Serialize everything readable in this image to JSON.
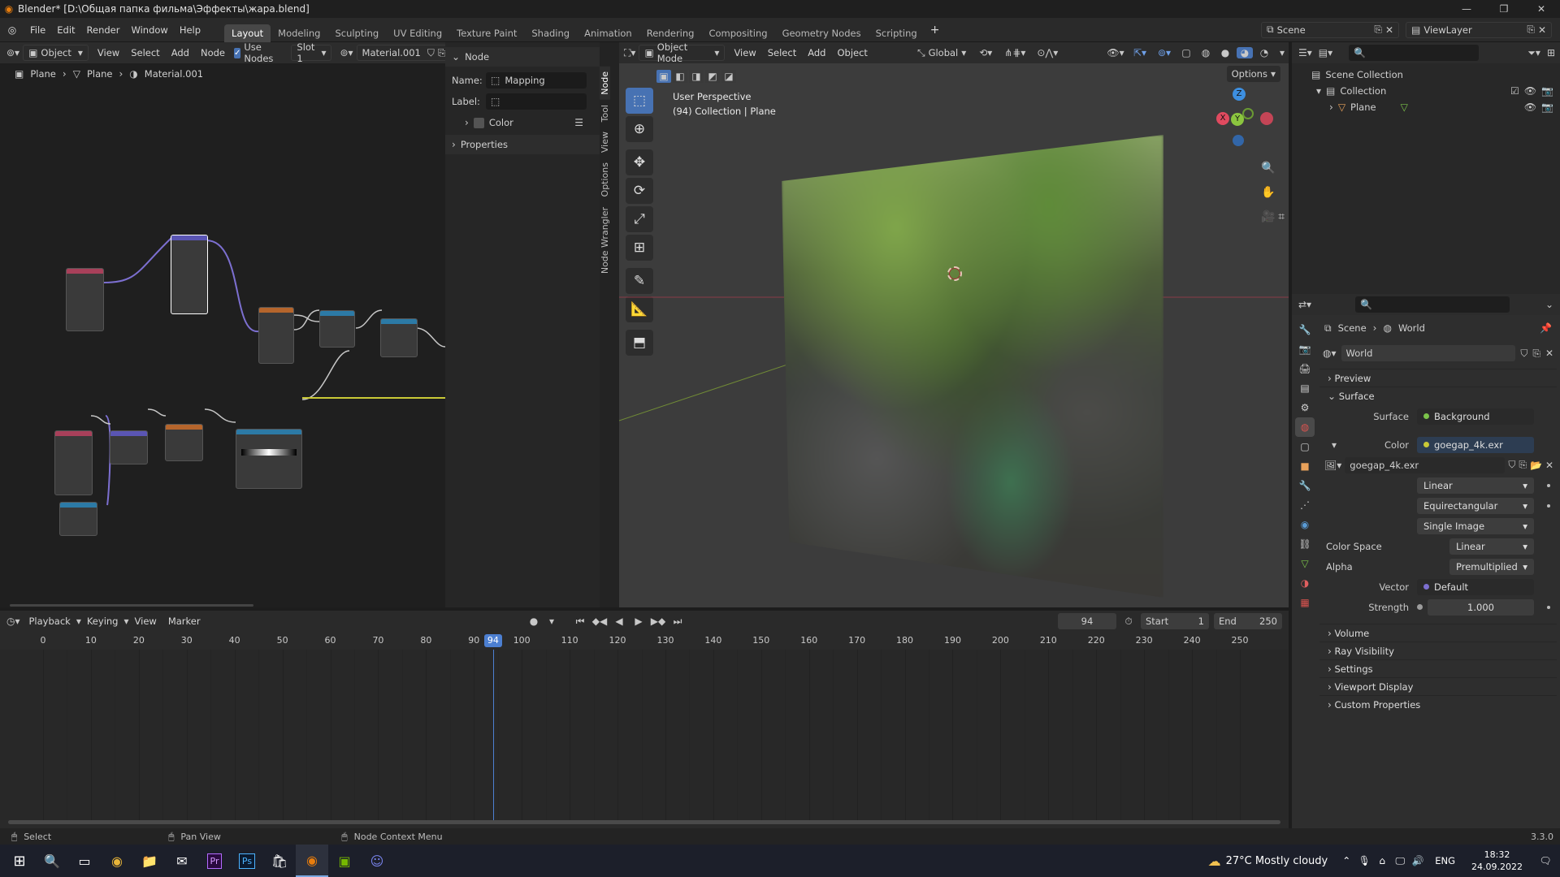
{
  "window": {
    "title": "Blender* [D:\\Общая папка фильма\\Эффекты\\жара.blend]",
    "min_icon": "—",
    "max_icon": "❐",
    "close_icon": "✕"
  },
  "menubar": {
    "items": [
      "File",
      "Edit",
      "Render",
      "Window",
      "Help"
    ]
  },
  "workspaces": {
    "tabs": [
      "Layout",
      "Modeling",
      "Sculpting",
      "UV Editing",
      "Texture Paint",
      "Shading",
      "Animation",
      "Rendering",
      "Compositing",
      "Geometry Nodes",
      "Scripting"
    ],
    "active": "Layout",
    "add": "+"
  },
  "scene": {
    "label": "Scene",
    "view_layer": "ViewLayer"
  },
  "node_editor": {
    "mode": "Object",
    "menus": [
      "View",
      "Select",
      "Add",
      "Node"
    ],
    "use_nodes": "Use Nodes",
    "slot": "Slot 1",
    "material": "Material.001",
    "breadcrumb": [
      "Plane",
      "Plane",
      "Material.001"
    ]
  },
  "npanel": {
    "section": "Node",
    "name_label": "Name:",
    "name_value": "Mapping",
    "label_label": "Label:",
    "label_value": "",
    "color": "Color",
    "properties": "Properties",
    "tabs": [
      "Node",
      "Tool",
      "View",
      "Options",
      "Node Wrangler"
    ]
  },
  "viewport": {
    "mode": "Object Mode",
    "menus": [
      "View",
      "Select",
      "Add",
      "Object"
    ],
    "orientation": "Global",
    "options": "Options",
    "perspective": "User Perspective",
    "collection": "(94) Collection | Plane",
    "gizmo": {
      "z": "Z",
      "y": "Y",
      "x": "X"
    }
  },
  "outliner": {
    "root": "Scene Collection",
    "collection": "Collection",
    "object": "Plane"
  },
  "properties": {
    "breadcrumb": [
      "Scene",
      "World"
    ],
    "world": "World",
    "sections": {
      "preview": "Preview",
      "surface": "Surface",
      "volume": "Volume",
      "ray_visibility": "Ray Visibility",
      "settings": "Settings",
      "viewport_display": "Viewport Display",
      "custom_properties": "Custom Properties"
    },
    "surface_label": "Surface",
    "surface_value": "Background",
    "color_label": "Color",
    "color_value": "goegap_4k.exr",
    "image_name": "goegap_4k.exr",
    "interp": "Linear",
    "projection": "Equirectangular",
    "source": "Single Image",
    "colorspace_label": "Color Space",
    "colorspace_value": "Linear",
    "alpha_label": "Alpha",
    "alpha_value": "Premultiplied",
    "vector_label": "Vector",
    "vector_value": "Default",
    "strength_label": "Strength",
    "strength_value": "1.000"
  },
  "timeline": {
    "menus": [
      "Playback",
      "Keying",
      "View",
      "Marker"
    ],
    "current_frame": "94",
    "start_label": "Start",
    "start_value": "1",
    "end_label": "End",
    "end_value": "250",
    "ticks": [
      "0",
      "10",
      "20",
      "30",
      "40",
      "50",
      "60",
      "70",
      "80",
      "90",
      "100",
      "110",
      "120",
      "130",
      "140",
      "150",
      "160",
      "170",
      "180",
      "190",
      "200",
      "210",
      "220",
      "230",
      "240",
      "250"
    ],
    "playhead": "94",
    "playhead_fraction": 0.376
  },
  "statusbar": {
    "select": "Select",
    "pan": "Pan View",
    "context": "Node Context Menu",
    "version": "3.3.0"
  },
  "taskbar": {
    "weather": "27°C  Mostly cloudy",
    "lang": "ENG",
    "time": "18:32",
    "date": "24.09.2022"
  },
  "colors": {
    "accent": "#4772b3",
    "playhead": "#4c7fd1",
    "x_axis": "#e04a5f",
    "y_axis": "#8bc53f",
    "z_axis": "#3d8fe0"
  }
}
